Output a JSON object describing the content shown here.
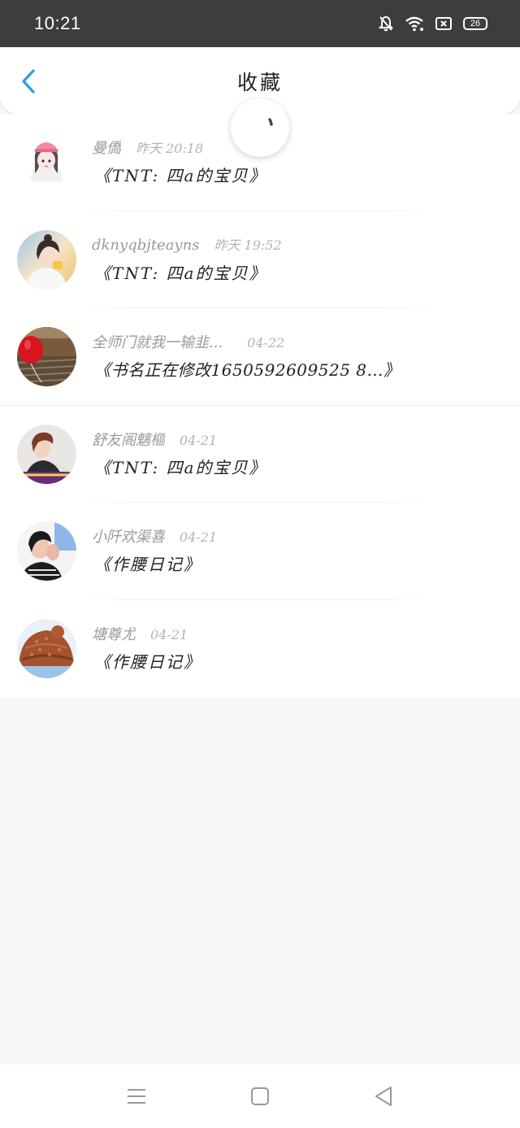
{
  "status_bar": {
    "time": "10:21",
    "battery_level": "26",
    "icons": [
      "bell-off-icon",
      "wifi-icon",
      "sim-icon",
      "battery-icon"
    ]
  },
  "header": {
    "title": "收藏",
    "back_icon": "chevron-left-icon",
    "accent_color": "#2d9cdb"
  },
  "favorites": [
    {
      "username": "曼僑",
      "time": "昨天 20:18",
      "book": "《TNT: 四a的宝贝》",
      "avatar": "avatar-girl-pink-hat"
    },
    {
      "username": "dknyqbjteayns",
      "time": "昨天 19:52",
      "book": "《TNT: 四a的宝贝》",
      "avatar": "avatar-girl-photo"
    },
    {
      "username": "全师门就我一输韭...",
      "time": "04-22",
      "book": "《书名正在修改1650592609525 8…》",
      "avatar": "avatar-red-balloon"
    },
    {
      "username": "舒友阁魑樞",
      "time": "04-21",
      "book": "《TNT: 四a的宝贝》",
      "avatar": "avatar-boy-photo"
    },
    {
      "username": "小阡欢渠喜",
      "time": "04-21",
      "book": "《作腰日记》",
      "avatar": "avatar-boy-hand"
    },
    {
      "username": "塘尊尤",
      "time": "04-21",
      "book": "《作腰日记》",
      "avatar": "avatar-knit-hat"
    }
  ],
  "nav_bar": {
    "icons": [
      "menu-icon",
      "home-square-icon",
      "back-triangle-icon"
    ]
  }
}
